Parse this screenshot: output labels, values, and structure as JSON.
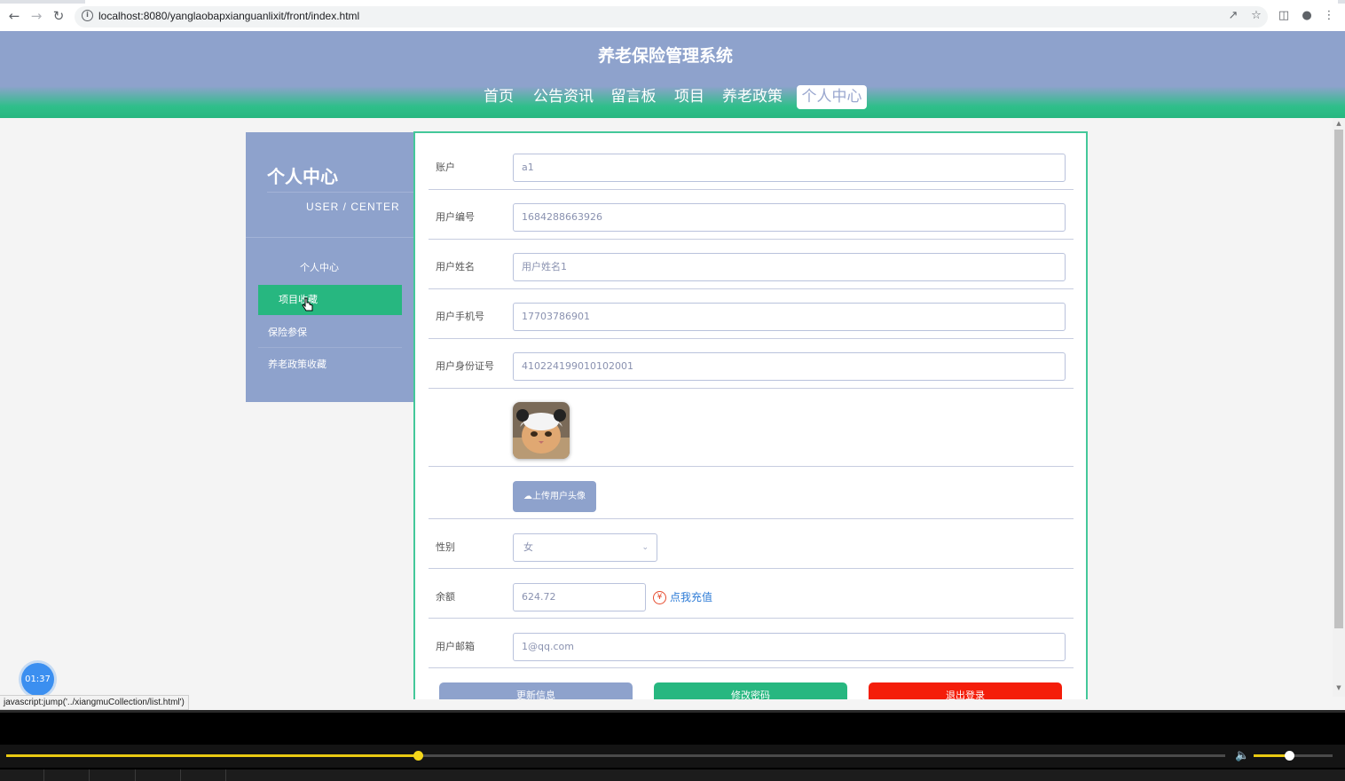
{
  "browser": {
    "url": "localhost:8080/yanglaobapxianguanlixit/front/index.html"
  },
  "site": {
    "title": "养老保险管理系统",
    "nav": [
      {
        "label": "首页"
      },
      {
        "label": "公告资讯"
      },
      {
        "label": "留言板"
      },
      {
        "label": "项目"
      },
      {
        "label": "养老政策"
      },
      {
        "label": "个人中心",
        "active": true
      }
    ]
  },
  "sidebar": {
    "title": "个人中心",
    "subtitle": "USER / CENTER",
    "items": [
      {
        "label": "个人中心"
      },
      {
        "label": "项目收藏",
        "active": true
      },
      {
        "label": "保险参保"
      },
      {
        "label": "养老政策收藏"
      }
    ]
  },
  "form": {
    "account": {
      "label": "账户",
      "value": "a1"
    },
    "user_no": {
      "label": "用户编号",
      "value": "1684288663926"
    },
    "user_name": {
      "label": "用户姓名",
      "value": "用户姓名1"
    },
    "phone": {
      "label": "用户手机号",
      "value": "17703786901"
    },
    "id_card": {
      "label": "用户身份证号",
      "value": "410224199010102001"
    },
    "upload_label": "上传用户头像",
    "gender": {
      "label": "性别",
      "value": "女"
    },
    "balance": {
      "label": "余额",
      "value": "624.72",
      "recharge": "点我充值"
    },
    "email": {
      "label": "用户邮箱",
      "value": "1@qq.com"
    },
    "buttons": [
      {
        "label": "更新信息",
        "color": "#8ea2cc"
      },
      {
        "label": "修改密码",
        "color": "#27b780"
      },
      {
        "label": "退出登录",
        "color": "#f41d0a"
      }
    ]
  },
  "overlay": {
    "timer": "01:37",
    "status_url": "javascript:jump('../xiangmuCollection/list.html')"
  },
  "player": {
    "progress": 0.338,
    "volume": 0.45
  },
  "colors": {
    "header": "#8ea2cc",
    "accent": "#27b780",
    "link": "#2d7bd6",
    "danger": "#f41d0a"
  }
}
